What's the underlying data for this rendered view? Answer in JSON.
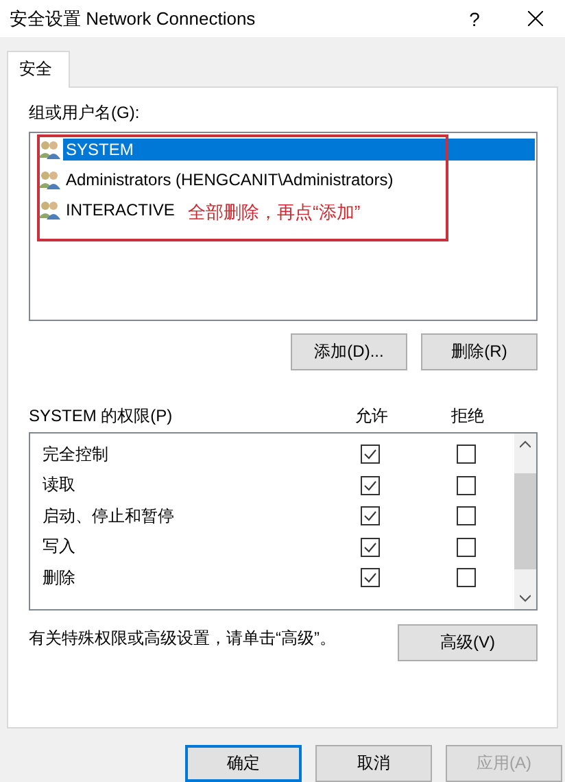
{
  "window": {
    "title": "安全设置 Network Connections",
    "help": "?"
  },
  "tabs": [
    {
      "label": "安全",
      "selected": true
    }
  ],
  "principals": {
    "label": "组或用户名(G):",
    "items": [
      {
        "name": "SYSTEM",
        "selected": true
      },
      {
        "name": "Administrators (HENGCANIT\\Administrators)",
        "selected": false
      },
      {
        "name": "INTERACTIVE",
        "selected": false
      }
    ],
    "annotation": "全部删除，再点“添加”",
    "buttons": [
      {
        "label": "添加(D)..."
      },
      {
        "label": "删除(R)"
      }
    ]
  },
  "permissions": {
    "label": "SYSTEM 的权限(P)",
    "columns": [
      "允许",
      "拒绝"
    ],
    "rows": [
      {
        "name": "完全控制",
        "allow": true,
        "deny": false
      },
      {
        "name": "读取",
        "allow": true,
        "deny": false
      },
      {
        "name": "启动、停止和暂停",
        "allow": true,
        "deny": false
      },
      {
        "name": "写入",
        "allow": true,
        "deny": false
      },
      {
        "name": "删除",
        "allow": true,
        "deny": false
      }
    ]
  },
  "advanced": {
    "note": "有关特殊权限或高级设置，请单击“高级”。",
    "button": "高级(V)"
  },
  "footer": [
    {
      "label": "确定",
      "default": true,
      "disabled": false
    },
    {
      "label": "取消",
      "default": false,
      "disabled": false
    },
    {
      "label": "应用(A)",
      "default": false,
      "disabled": true
    }
  ]
}
